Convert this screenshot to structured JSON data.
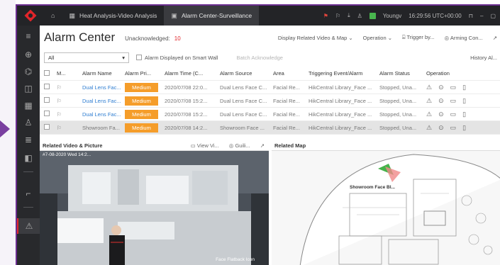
{
  "titlebar": {
    "tabs": [
      {
        "label": "Heat Analysis-Video Analysis"
      },
      {
        "label": "Alarm Center-Surveillance"
      }
    ],
    "user": "Youngv",
    "time": "16:29:56 UTC+00:00"
  },
  "header": {
    "title": "Alarm Center",
    "unack_label": "Unacknowledged:",
    "unack_count": "10",
    "actions": {
      "map": "Display Related Video & Map ⌄",
      "operation": "Operation ⌄",
      "trigger": "Trigger by...",
      "arming": "Arming Con..."
    }
  },
  "filter": {
    "selected": "All",
    "smartwall": "Alarm Displayed on Smart Wall",
    "batch": "Batch Acknowledge",
    "history": "History Al..."
  },
  "table": {
    "headers": [
      "M...",
      "Alarm Name",
      "Alarm Pri...",
      "Alarm Time (C...",
      "Alarm Source",
      "Area",
      "Triggering Event/Alarm",
      "Alarm Status",
      "Operation"
    ],
    "rows": [
      {
        "name": "Dual Lens Fac...",
        "priority": "Medium",
        "time": "2020/07/08 22:0...",
        "source": "Dual Lens Face C...",
        "area": "Facial Re...",
        "event": "HikCentral Library_Face ...",
        "status": "Stopped, Una..."
      },
      {
        "name": "Dual Lens Fac...",
        "priority": "Medium",
        "time": "2020/07/08 15:2...",
        "source": "Dual Lens Face C...",
        "area": "Facial Re...",
        "event": "HikCentral Library_Face ...",
        "status": "Stopped, Una..."
      },
      {
        "name": "Dual Lens Fac...",
        "priority": "Medium",
        "time": "2020/07/08 15:2...",
        "source": "Dual Lens Face C...",
        "area": "Facial Re...",
        "event": "HikCentral Library_Face ...",
        "status": "Stopped, Una..."
      },
      {
        "name": "Showroom Fa...",
        "priority": "Medium",
        "time": "2020/07/08 14:2...",
        "source": "Showroom Face ...",
        "area": "Facial Re...",
        "event": "HikCentral Library_Face ...",
        "status": "Stopped, Una..."
      }
    ]
  },
  "video": {
    "title": "Related Video & Picture",
    "view": "View Vi...",
    "guild": "Guili...",
    "overlay_top": "#7-08-2020 Wed 14:2...",
    "overlay_name": "Face Flatback Icon"
  },
  "map": {
    "title": "Related Map",
    "label": "Showroom Face Bl..."
  },
  "colors": {
    "accent": "#e1252a",
    "medium": "#f59d2a",
    "link": "#2e7dd1",
    "frame": "#6b2d8f"
  }
}
